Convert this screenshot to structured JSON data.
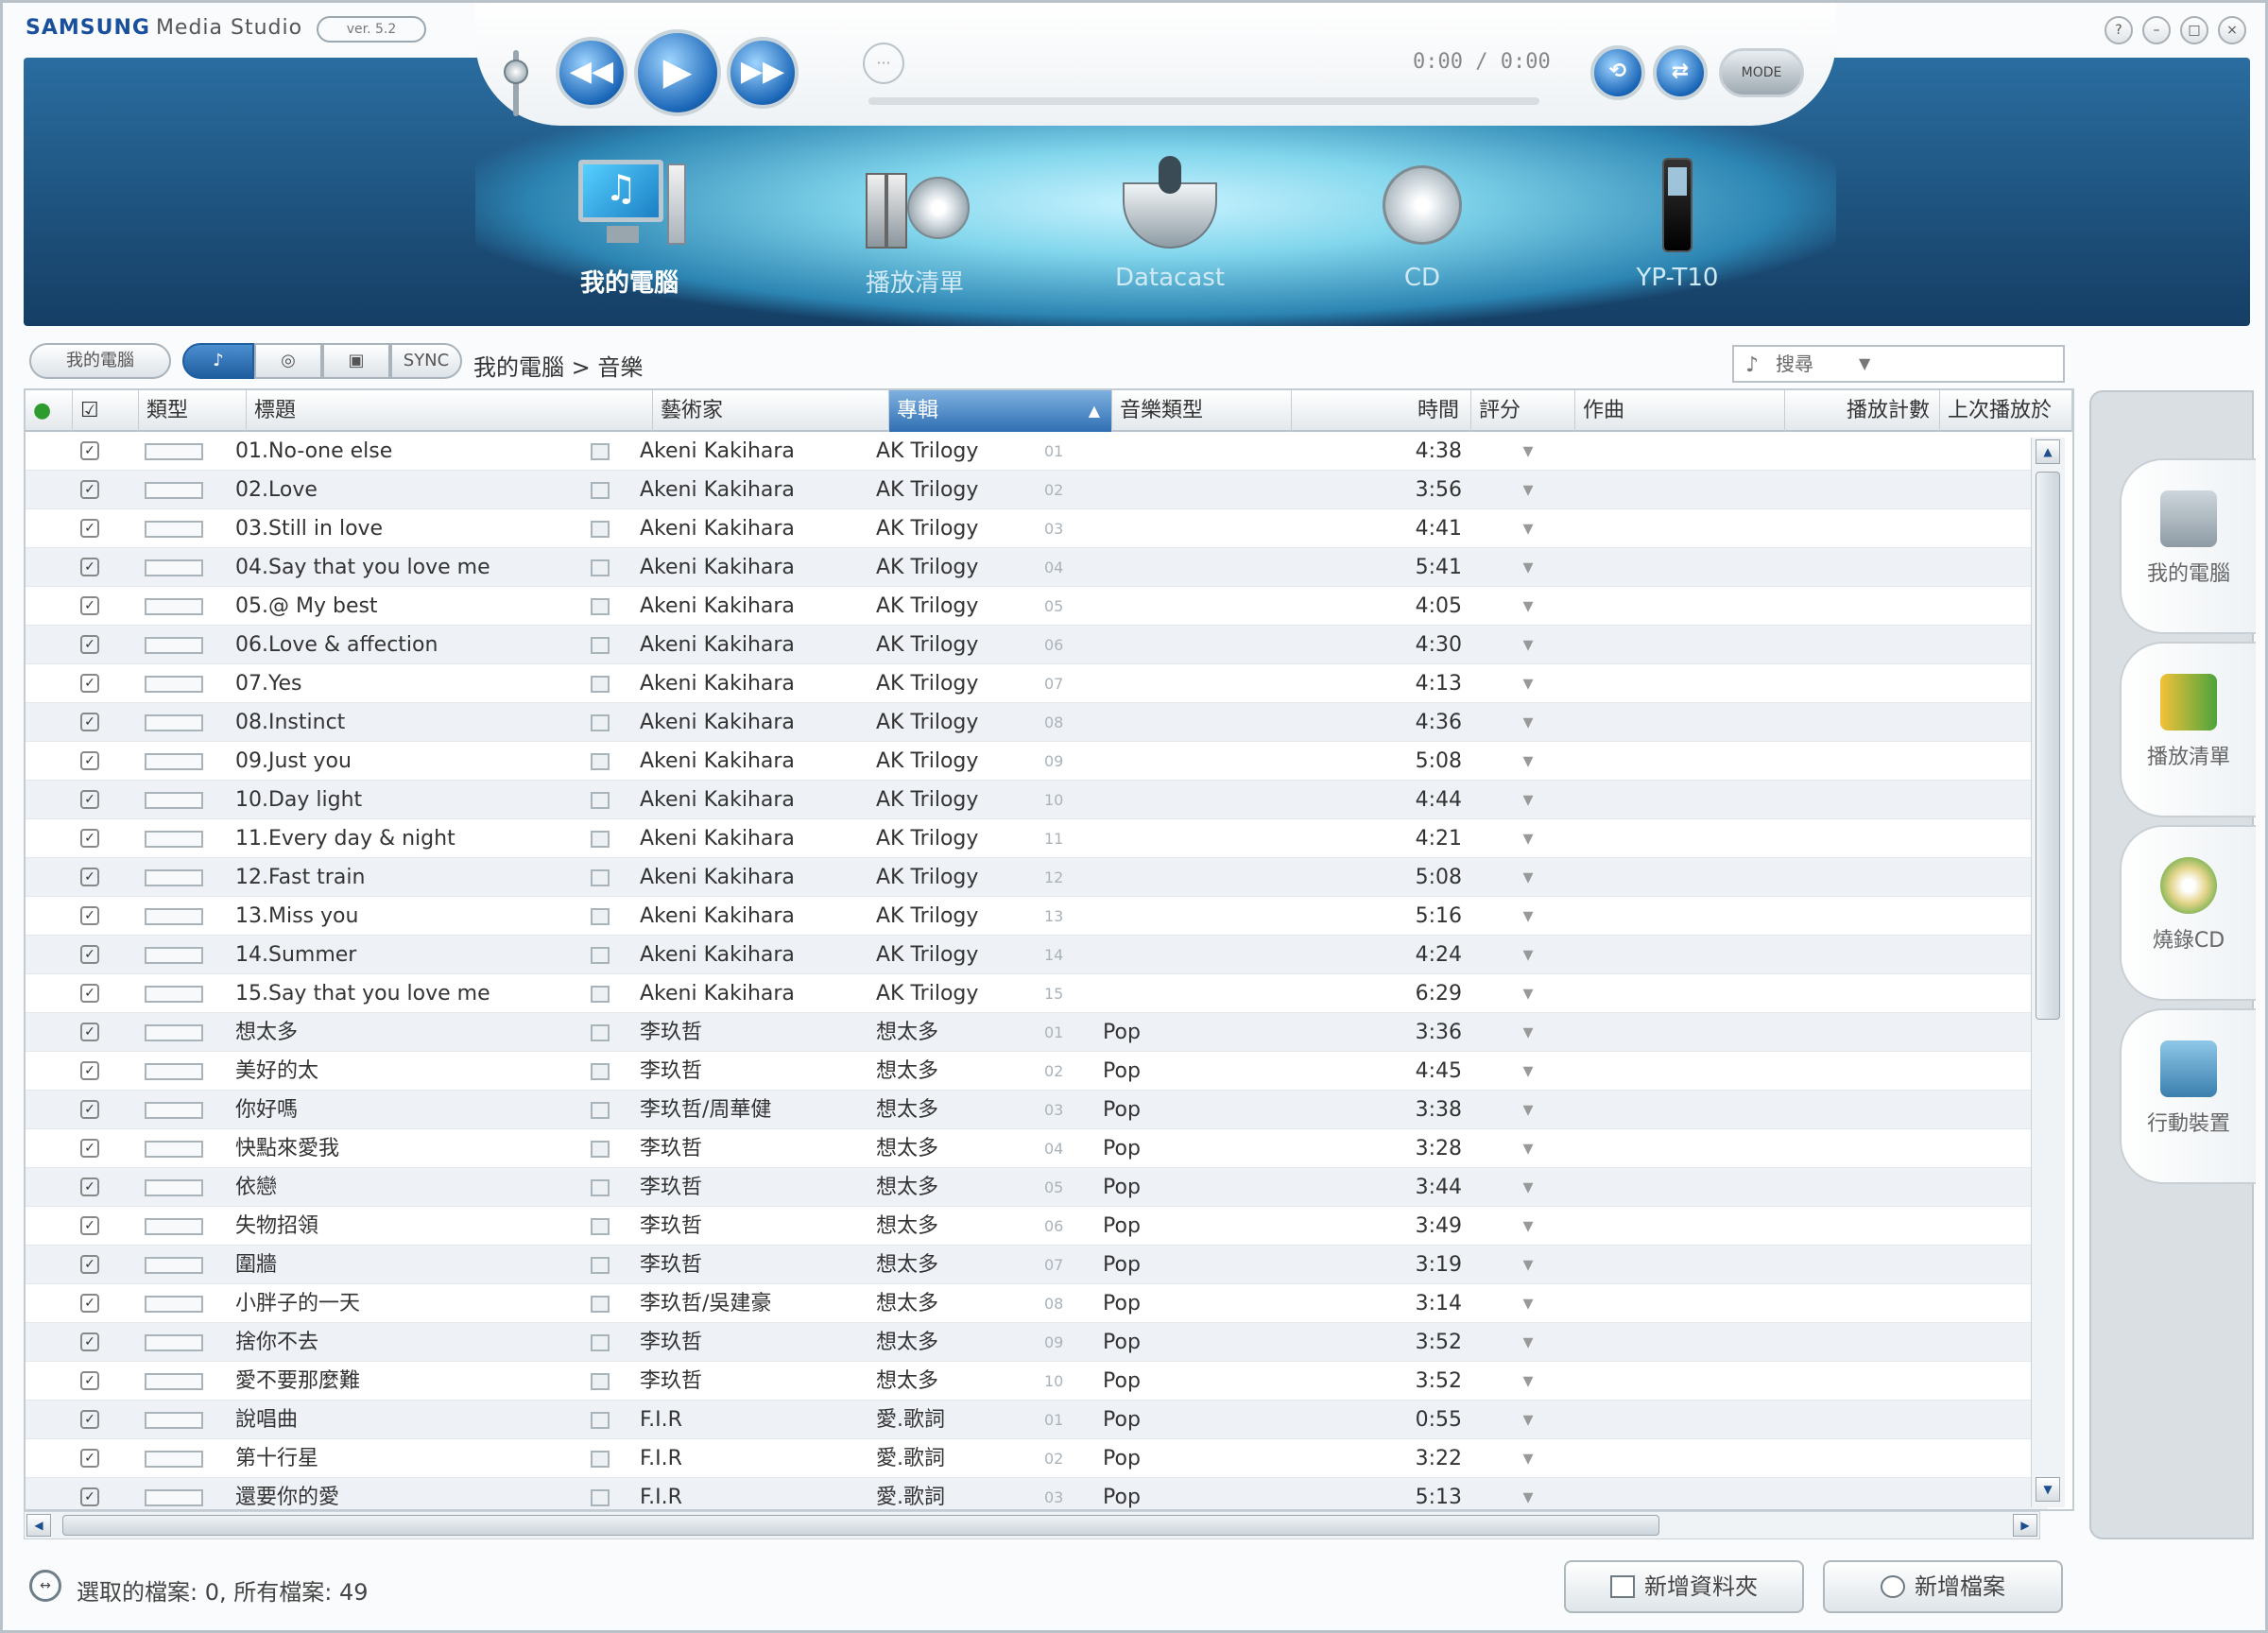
{
  "app": {
    "brand": "SAMSUNG",
    "product": "Media Studio",
    "badge": "ver. 5.2"
  },
  "player": {
    "time": "0:00 / 0:00",
    "pill_label": "MODE"
  },
  "nav": [
    {
      "label": "我的電腦",
      "active": true
    },
    {
      "label": "播放清單",
      "active": false
    },
    {
      "label": "Datacast",
      "active": false
    },
    {
      "label": "CD",
      "active": false
    },
    {
      "label": "YP-T10",
      "active": false
    }
  ],
  "toolbar": {
    "my_pc_btn": "我的電腦",
    "sync_label": "SYNC",
    "breadcrumb": "我的電腦 > 音樂",
    "search_placeholder": "搜尋"
  },
  "columns": [
    "類型",
    "標題",
    "藝術家",
    "專輯",
    "音樂類型",
    "時間",
    "評分",
    "作曲",
    "播放計數",
    "上次播放於"
  ],
  "rows": [
    {
      "title": "01.No-one else",
      "artist": "Akeni Kakihara",
      "album": "AK Trilogy",
      "track": "01",
      "genre": "",
      "time": "4:38"
    },
    {
      "title": "02.Love",
      "artist": "Akeni Kakihara",
      "album": "AK Trilogy",
      "track": "02",
      "genre": "",
      "time": "3:56"
    },
    {
      "title": "03.Still in love",
      "artist": "Akeni Kakihara",
      "album": "AK Trilogy",
      "track": "03",
      "genre": "",
      "time": "4:41"
    },
    {
      "title": "04.Say that you love me",
      "artist": "Akeni Kakihara",
      "album": "AK Trilogy",
      "track": "04",
      "genre": "",
      "time": "5:41"
    },
    {
      "title": "05.@ My best",
      "artist": "Akeni Kakihara",
      "album": "AK Trilogy",
      "track": "05",
      "genre": "",
      "time": "4:05"
    },
    {
      "title": "06.Love & affection",
      "artist": "Akeni Kakihara",
      "album": "AK Trilogy",
      "track": "06",
      "genre": "",
      "time": "4:30"
    },
    {
      "title": "07.Yes",
      "artist": "Akeni Kakihara",
      "album": "AK Trilogy",
      "track": "07",
      "genre": "",
      "time": "4:13"
    },
    {
      "title": "08.Instinct",
      "artist": "Akeni Kakihara",
      "album": "AK Trilogy",
      "track": "08",
      "genre": "",
      "time": "4:36"
    },
    {
      "title": "09.Just you",
      "artist": "Akeni Kakihara",
      "album": "AK Trilogy",
      "track": "09",
      "genre": "",
      "time": "5:08"
    },
    {
      "title": "10.Day light",
      "artist": "Akeni Kakihara",
      "album": "AK Trilogy",
      "track": "10",
      "genre": "",
      "time": "4:44"
    },
    {
      "title": "11.Every day & night",
      "artist": "Akeni Kakihara",
      "album": "AK Trilogy",
      "track": "11",
      "genre": "",
      "time": "4:21"
    },
    {
      "title": "12.Fast train",
      "artist": "Akeni Kakihara",
      "album": "AK Trilogy",
      "track": "12",
      "genre": "",
      "time": "5:08"
    },
    {
      "title": "13.Miss you",
      "artist": "Akeni Kakihara",
      "album": "AK Trilogy",
      "track": "13",
      "genre": "",
      "time": "5:16"
    },
    {
      "title": "14.Summer",
      "artist": "Akeni Kakihara",
      "album": "AK Trilogy",
      "track": "14",
      "genre": "",
      "time": "4:24"
    },
    {
      "title": "15.Say that you love me",
      "artist": "Akeni Kakihara",
      "album": "AK Trilogy",
      "track": "15",
      "genre": "",
      "time": "6:29"
    },
    {
      "title": "想太多",
      "artist": "李玖哲",
      "album": "想太多",
      "track": "01",
      "genre": "Pop",
      "time": "3:36"
    },
    {
      "title": "美好的太",
      "artist": "李玖哲",
      "album": "想太多",
      "track": "02",
      "genre": "Pop",
      "time": "4:45"
    },
    {
      "title": "你好嗎",
      "artist": "李玖哲/周華健",
      "album": "想太多",
      "track": "03",
      "genre": "Pop",
      "time": "3:38"
    },
    {
      "title": "快點來愛我",
      "artist": "李玖哲",
      "album": "想太多",
      "track": "04",
      "genre": "Pop",
      "time": "3:28"
    },
    {
      "title": "依戀",
      "artist": "李玖哲",
      "album": "想太多",
      "track": "05",
      "genre": "Pop",
      "time": "3:44"
    },
    {
      "title": "失物招領",
      "artist": "李玖哲",
      "album": "想太多",
      "track": "06",
      "genre": "Pop",
      "time": "3:49"
    },
    {
      "title": "圍牆",
      "artist": "李玖哲",
      "album": "想太多",
      "track": "07",
      "genre": "Pop",
      "time": "3:19"
    },
    {
      "title": "小胖子的一天",
      "artist": "李玖哲/吳建豪",
      "album": "想太多",
      "track": "08",
      "genre": "Pop",
      "time": "3:14"
    },
    {
      "title": "捨你不去",
      "artist": "李玖哲",
      "album": "想太多",
      "track": "09",
      "genre": "Pop",
      "time": "3:52"
    },
    {
      "title": "愛不要那麼難",
      "artist": "李玖哲",
      "album": "想太多",
      "track": "10",
      "genre": "Pop",
      "time": "3:52"
    },
    {
      "title": "說唱曲",
      "artist": "F.I.R",
      "album": "愛.歌詞",
      "track": "01",
      "genre": "Pop",
      "time": "0:55"
    },
    {
      "title": "第十行星",
      "artist": "F.I.R",
      "album": "愛.歌詞",
      "track": "02",
      "genre": "Pop",
      "time": "3:22"
    },
    {
      "title": "還要你的愛",
      "artist": "F.I.R",
      "album": "愛.歌詞",
      "track": "03",
      "genre": "Pop",
      "time": "5:13"
    }
  ],
  "right_panel": [
    {
      "label": "我的電腦",
      "icon": "monitor-icon"
    },
    {
      "label": "播放清單",
      "icon": "playlist-icon"
    },
    {
      "label": "燒錄CD",
      "icon": "burn-cd-icon"
    },
    {
      "label": "行動裝置",
      "icon": "device-icon"
    }
  ],
  "status": {
    "text": "選取的檔案: 0, 所有檔案: 49"
  },
  "buttons": {
    "add_folder": "新增資料夾",
    "add_file": "新增檔案"
  }
}
